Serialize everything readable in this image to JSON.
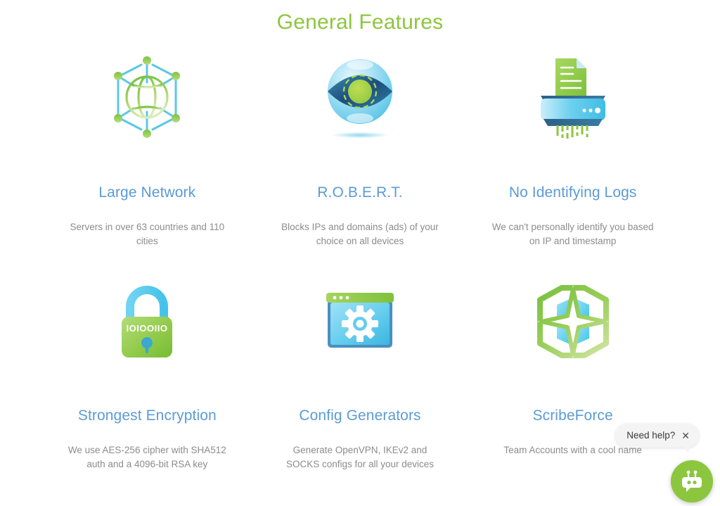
{
  "page": {
    "title": "General Features",
    "title_color": "#8dc63f",
    "feature_title_color": "#5b9bd5",
    "feature_desc_color": "#8c8c8c",
    "background": "#ffffff"
  },
  "features": [
    {
      "icon": "globe-network-icon",
      "title": "Large Network",
      "desc": "Servers in over 63 countries and 110 cities"
    },
    {
      "icon": "eye-sphere-icon",
      "title": "R.O.B.E.R.T.",
      "desc": "Blocks IPs and domains (ads) of your choice on all devices"
    },
    {
      "icon": "paper-shredder-icon",
      "title": "No Identifying Logs",
      "desc": "We can't personally identify you based on IP and timestamp"
    },
    {
      "icon": "padlock-binary-icon",
      "title": "Strongest Encryption",
      "desc": "We use AES-256 cipher with SHA512 auth and a 4096-bit RSA key"
    },
    {
      "icon": "browser-gear-icon",
      "title": "Config Generators",
      "desc": "Generate OpenVPN, IKEv2 and SOCKS configs for all your devices"
    },
    {
      "icon": "compass-star-icon",
      "title": "ScribeForce",
      "desc": "Team Accounts with a cool name"
    }
  ],
  "icon_labels": {
    "padlock_binary_text": "IOIOOIIO"
  },
  "chat_widget": {
    "prompt": "Need help?",
    "close_label": "✕",
    "fab_color": "#8cc63e",
    "fab_icon": "chat-robot-icon"
  }
}
